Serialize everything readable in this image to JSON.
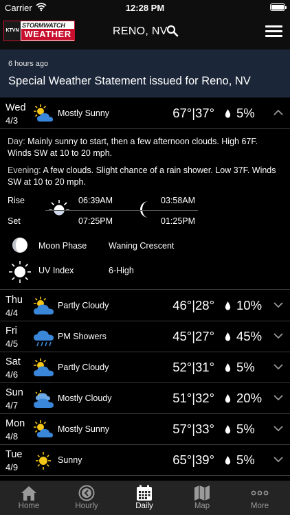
{
  "status_bar": {
    "carrier": "Carrier",
    "time": "12:28 PM"
  },
  "header": {
    "logo_top": "STORMWATCH",
    "logo_main": "WEATHER",
    "logo_station": "KTVN",
    "location": "RENO, NV"
  },
  "alert": {
    "time_ago": "6 hours ago",
    "text": "Special Weather Statement issued for Reno, NV"
  },
  "days": [
    {
      "day": "Wed",
      "date": "4/3",
      "condition": "Mostly Sunny",
      "icon": "mostly-sunny-icon",
      "temps": "67°|37°",
      "precip": "5%",
      "expanded": true
    },
    {
      "day": "Thu",
      "date": "4/4",
      "condition": "Partly Cloudy",
      "icon": "partly-cloudy-icon",
      "temps": "46°|28°",
      "precip": "10%"
    },
    {
      "day": "Fri",
      "date": "4/5",
      "condition": "PM Showers",
      "icon": "showers-icon",
      "temps": "45°|27°",
      "precip": "45%"
    },
    {
      "day": "Sat",
      "date": "4/6",
      "condition": "Partly Cloudy",
      "icon": "partly-cloudy-icon",
      "temps": "52°|31°",
      "precip": "5%"
    },
    {
      "day": "Sun",
      "date": "4/7",
      "condition": "Mostly Cloudy",
      "icon": "mostly-cloudy-icon",
      "temps": "51°|32°",
      "precip": "20%"
    },
    {
      "day": "Mon",
      "date": "4/8",
      "condition": "Mostly Sunny",
      "icon": "mostly-sunny-icon",
      "temps": "57°|33°",
      "precip": "5%"
    },
    {
      "day": "Tue",
      "date": "4/9",
      "condition": "Sunny",
      "icon": "sunny-icon",
      "temps": "65°|39°",
      "precip": "5%"
    }
  ],
  "detail": {
    "day_label": "Day:",
    "day_text": " Mainly sunny to start, then a few afternoon clouds. High 67F. Winds SW at 10 to 20 mph.",
    "evening_label": "Evening:",
    "evening_text": " A few clouds. Slight chance of a rain shower. Low 37F. Winds SW at 10 to 20 mph.",
    "rise_label": "Rise",
    "set_label": "Set",
    "sunrise": "06:39AM",
    "sunset": "07:25PM",
    "moonrise": "03:58AM",
    "moonset": "01:25PM",
    "moon_phase_label": "Moon Phase",
    "moon_phase_value": "Waning Crescent",
    "uv_label": "UV Index",
    "uv_value": "6-High"
  },
  "tabs": [
    {
      "label": "Home",
      "icon": "home-icon"
    },
    {
      "label": "Hourly",
      "icon": "clock-icon"
    },
    {
      "label": "Daily",
      "icon": "calendar-icon",
      "active": true
    },
    {
      "label": "Map",
      "icon": "map-icon"
    },
    {
      "label": "More",
      "icon": "more-dots-icon"
    }
  ],
  "colors": {
    "alert_bg": "#1b2638",
    "brand_red": "#c8102e",
    "sun": "#f5c518",
    "cloud": "#3a86d8"
  }
}
